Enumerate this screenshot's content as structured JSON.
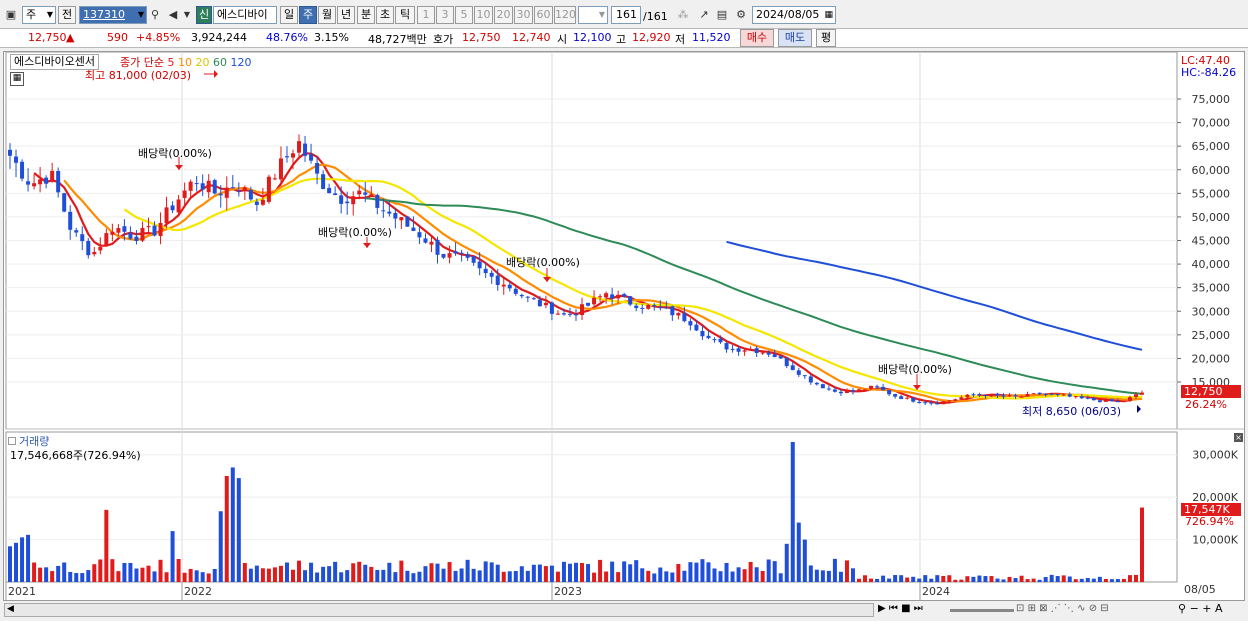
{
  "toolbar": {
    "market_type": "주",
    "prev_label": "전",
    "code": "137310",
    "new_badge": "신",
    "stock_name": "에스디바이",
    "periods": [
      "일",
      "주",
      "월",
      "년",
      "분",
      "초",
      "틱"
    ],
    "selected_period": "주",
    "intervals": [
      "1",
      "3",
      "5",
      "10",
      "20",
      "30",
      "60",
      "120"
    ],
    "page_counter": "161",
    "page_total": "/161",
    "date": "2024/08/05"
  },
  "quote": {
    "price": "12,750",
    "change_arrow": "▲",
    "change": "590",
    "change_pct": "+4.85%",
    "volume": "3,924,244",
    "vol_ratio": "48.76%",
    "turnover": "3.15%",
    "amount": "48,727백만",
    "ask_label": "호가",
    "ask": "12,750",
    "bid": "12,740",
    "open_label": "시",
    "open": "12,100",
    "high_label": "고",
    "high": "12,920",
    "low_label": "저",
    "low": "11,520",
    "buy_button": "매수",
    "sell_button": "매도",
    "eval_button": "평"
  },
  "price_panel": {
    "title": "에스디바이오센서",
    "ma_label": "종가 단순",
    "ma_periods": [
      "5",
      "10",
      "20",
      "60",
      "120"
    ],
    "ma_colors": [
      "#e01b1b",
      "#ff8c00",
      "#f5e600",
      "#2e8b57",
      "#1f4fd8"
    ],
    "lc_label": "LC:47.40",
    "hc_label": "HC:-84.26",
    "high_annotation": "최고 81,000 (02/03)",
    "low_annotation": "최저 8,650 (06/03)",
    "dividend_label": "배당락(0.00%)",
    "current_price_tag": "12,750",
    "current_pct_tag": "26.24%",
    "y_ticks": [
      "75,000",
      "70,000",
      "65,000",
      "60,000",
      "55,000",
      "50,000",
      "45,000",
      "40,000",
      "35,000",
      "30,000",
      "25,000",
      "20,000",
      "15,000"
    ]
  },
  "volume_panel": {
    "title": "거래량",
    "summary": "17,546,668주(726.94%)",
    "y_ticks": [
      "30,000K",
      "20,000K",
      "10,000K"
    ],
    "current_tag": "17,547K",
    "current_pct": "726.94%"
  },
  "x_axis": {
    "labels": [
      "2021",
      "2022",
      "2023",
      "2024"
    ],
    "end_label": "08/05"
  },
  "colors": {
    "up": "#e01b1b",
    "down": "#1f4fd8",
    "selected": "#3f6fb1"
  },
  "chart_data": {
    "type": "candlestick",
    "title": "에스디바이오센서",
    "x_start_date": "2021-01",
    "x_end_date": "2024-08-05",
    "price_range": [
      8650,
      81000
    ],
    "price_high": {
      "value": 81000,
      "date": "02/03"
    },
    "price_low": {
      "value": 8650,
      "date": "06/03"
    },
    "last_close": 12750,
    "close_series_approx": [
      63000,
      57000,
      59000,
      47000,
      42000,
      48000,
      46000,
      47000,
      53000,
      58000,
      55000,
      57000,
      53000,
      60000,
      66000,
      58000,
      54000,
      55000,
      52000,
      49000,
      46000,
      42000,
      41000,
      38000,
      36000,
      33000,
      31000,
      29000,
      31000,
      34000,
      32000,
      31000,
      30000,
      28000,
      24000,
      22000,
      22000,
      21000,
      18000,
      15000,
      13000,
      13000,
      14000,
      12000,
      11000,
      10500,
      11500,
      12500,
      12000,
      11800,
      12500,
      12200,
      11500,
      11000,
      10800,
      12750
    ],
    "moving_averages": [
      {
        "name": "5",
        "color": "#e01b1b"
      },
      {
        "name": "10",
        "color": "#ff8c00"
      },
      {
        "name": "20",
        "color": "#f5e600"
      },
      {
        "name": "60",
        "color": "#2e8b57"
      },
      {
        "name": "120",
        "color": "#1f4fd8"
      }
    ],
    "volume_last": 17546668,
    "volume_ylim": [
      0,
      33000000
    ]
  }
}
